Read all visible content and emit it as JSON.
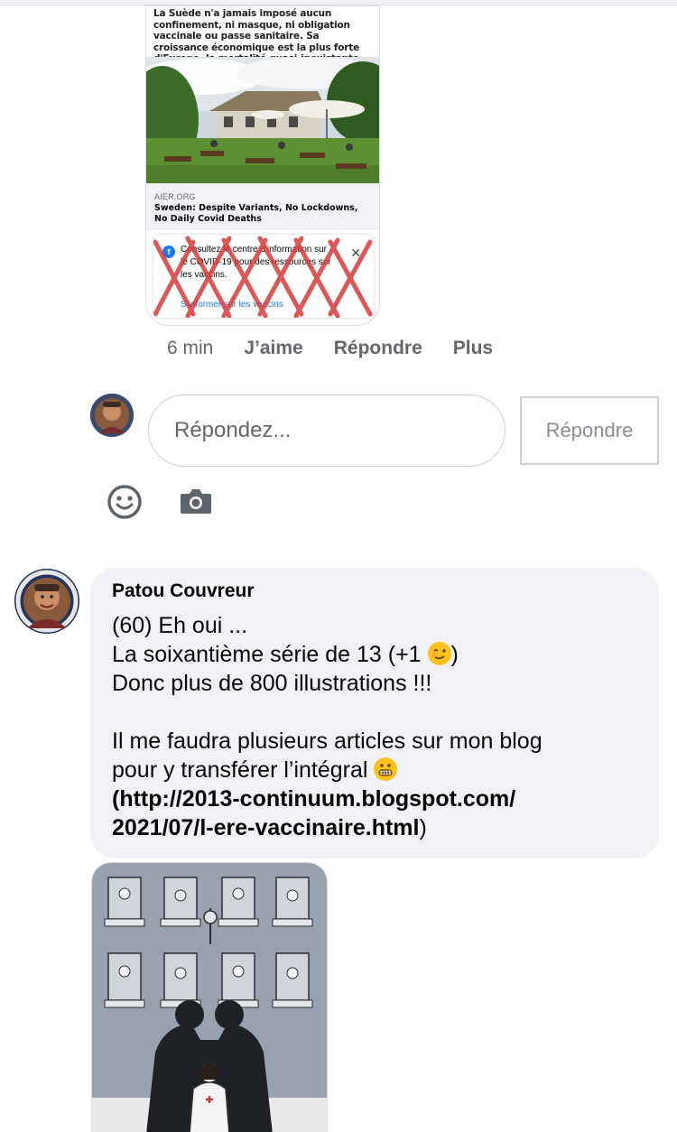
{
  "shared_post": {
    "caption": "La Suède n'a jamais imposé aucun confinement, ni masque, ni obligation vaccinale ou passe sanitaire. Sa croissance économique est la plus forte d'Europe, la mortalité quasi-inexistante.",
    "link_domain": "AIER.ORG",
    "link_title": "Sweden: Despite Variants, No Lockdowns, No Daily Covid Deaths",
    "covid_notice_text": "Consultez le centre d'information sur le COVID-19 pour des ressources sur les vaccins.",
    "covid_notice_link": "S'informer sur les vaccins"
  },
  "actions": {
    "time": "6 min",
    "like": "J’aime",
    "reply": "Répondre",
    "more": "Plus"
  },
  "composer": {
    "placeholder": "Répondez...",
    "submit": "Répondre"
  },
  "comment": {
    "author": "Patou Couvreur",
    "lines": [
      "(60) Eh oui ...",
      "La soixantième série de 13 (+1 ",
      ")",
      "Donc plus de 800 illustrations !!!",
      "Il me faudra plusieurs articles sur mon blog",
      "pour y transférer l’intégral ",
      "(http://2013-continuum.blogspot.com/",
      "2021/07/l-ere-vaccinaire.html",
      ")"
    ]
  },
  "icons": {
    "emoji": "smiley-icon",
    "camera": "camera-icon",
    "wink": "winking-face-emoji",
    "grimace": "grimacing-face-emoji"
  },
  "colors": {
    "bubble_bg": "#f0f2f5",
    "secondary_text": "#65676b",
    "link_blue": "#1877f2",
    "cross_red": "#d93a3a"
  }
}
